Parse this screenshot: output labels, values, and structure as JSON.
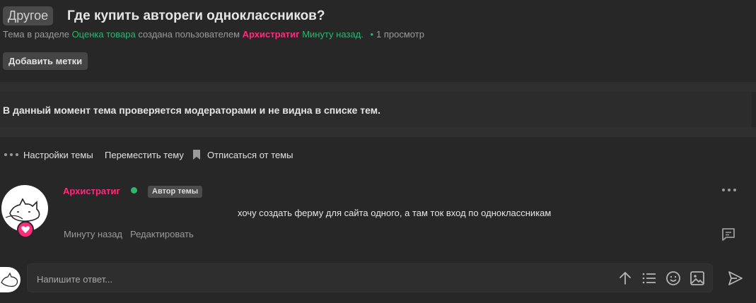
{
  "thread": {
    "prefix": "Другое",
    "title": "Где купить автореги одноклассников?",
    "meta": {
      "section_prefix": "Тема в разделе",
      "section": "Оценка товара",
      "created_by": "создана пользователем",
      "author": "Архистратиг",
      "time": "Минуту назад.",
      "views": "1 просмотр"
    },
    "add_tags_label": "Добавить метки"
  },
  "notice": {
    "text": "В данный момент тема проверяется модераторами и не видна в списке тем."
  },
  "actions": {
    "settings": "Настройки темы",
    "move": "Переместить тему",
    "unsubscribe": "Отписаться от темы"
  },
  "post": {
    "author": "Архистратиг",
    "badge": "Автор темы",
    "text": "хочу создать ферму для сайта одного, а там ток вход по одноклассникам",
    "time": "Минуту назад",
    "edit_label": "Редактировать"
  },
  "reply": {
    "placeholder": "Напишите ответ..."
  },
  "colors": {
    "background": "#272727",
    "accent_pink": "#ff2c7a",
    "accent_green": "#2bb673"
  },
  "icons": [
    "more-dots-icon",
    "bookmark-icon",
    "heart-icon",
    "post-menu-icon",
    "reply-icon",
    "arrow-up-icon",
    "list-icon",
    "smile-icon",
    "image-icon",
    "send-icon"
  ]
}
